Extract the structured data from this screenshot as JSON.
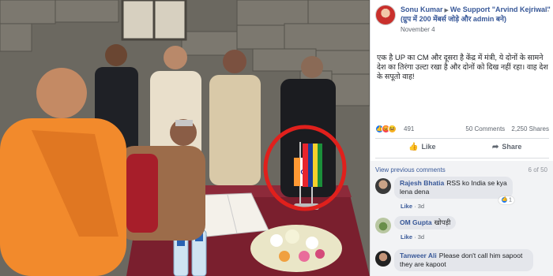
{
  "post": {
    "author": "Sonu Kumar",
    "group": "We Support \"Arvind Kejriwal\" (ग्रुप में 200 मेंबर्स जोड़े और admin बने)",
    "date": "November 4",
    "more_icon": "more-options-icon",
    "text": "एक है UP का CM और दूसरा है केंद्र में मंत्री, ये दोनों के सामने देश का तिरंगा उल्टा रखा है और दोनों को दिख नहीं रहा। वाह देश के सपूतो वाह!",
    "reaction_count": "491",
    "comments_count": "50 Comments",
    "shares_count": "2,250 Shares",
    "like_label": "Like",
    "share_label": "Share"
  },
  "comments_section": {
    "view_previous": "View previous comments",
    "position": "6 of 50",
    "items": [
      {
        "name": "Rajesh Bhatia",
        "text": "RSS ko India se kya lena dena",
        "like": "Like",
        "time": "3d",
        "reactions": "1"
      },
      {
        "name": "OM Gupta",
        "text": "खोपड़ी",
        "like": "Like",
        "time": "3d"
      },
      {
        "name": "Tanweer Ali",
        "text": "Please don't call him sapoot they are kapoot",
        "like": "",
        "time": ""
      }
    ]
  },
  "colors": {
    "facebook_link": "#385898",
    "highlight_circle": "#e0201c",
    "saffron_robe": "#f28a2c"
  }
}
